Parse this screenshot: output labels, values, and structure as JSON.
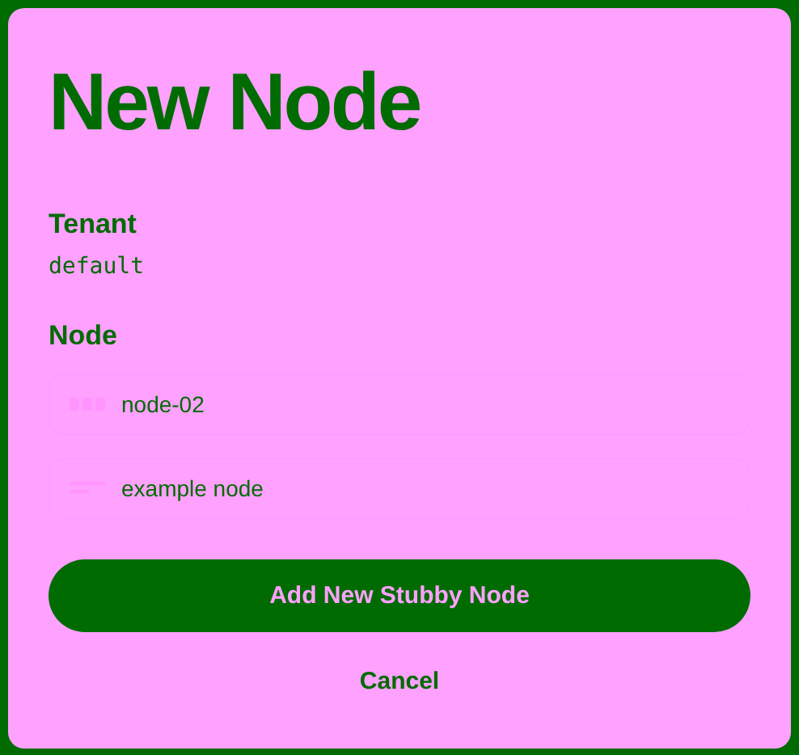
{
  "dialog": {
    "title": "New Node",
    "tenant": {
      "label": "Tenant",
      "value": "default"
    },
    "node": {
      "label": "Node",
      "fields": [
        {
          "kind": "name",
          "value": "node-02"
        },
        {
          "kind": "description",
          "value": "example node"
        }
      ]
    },
    "buttons": [
      {
        "kind": "primary",
        "label": "Add New Stubby Node"
      },
      {
        "kind": "link",
        "label": "Cancel"
      }
    ]
  }
}
